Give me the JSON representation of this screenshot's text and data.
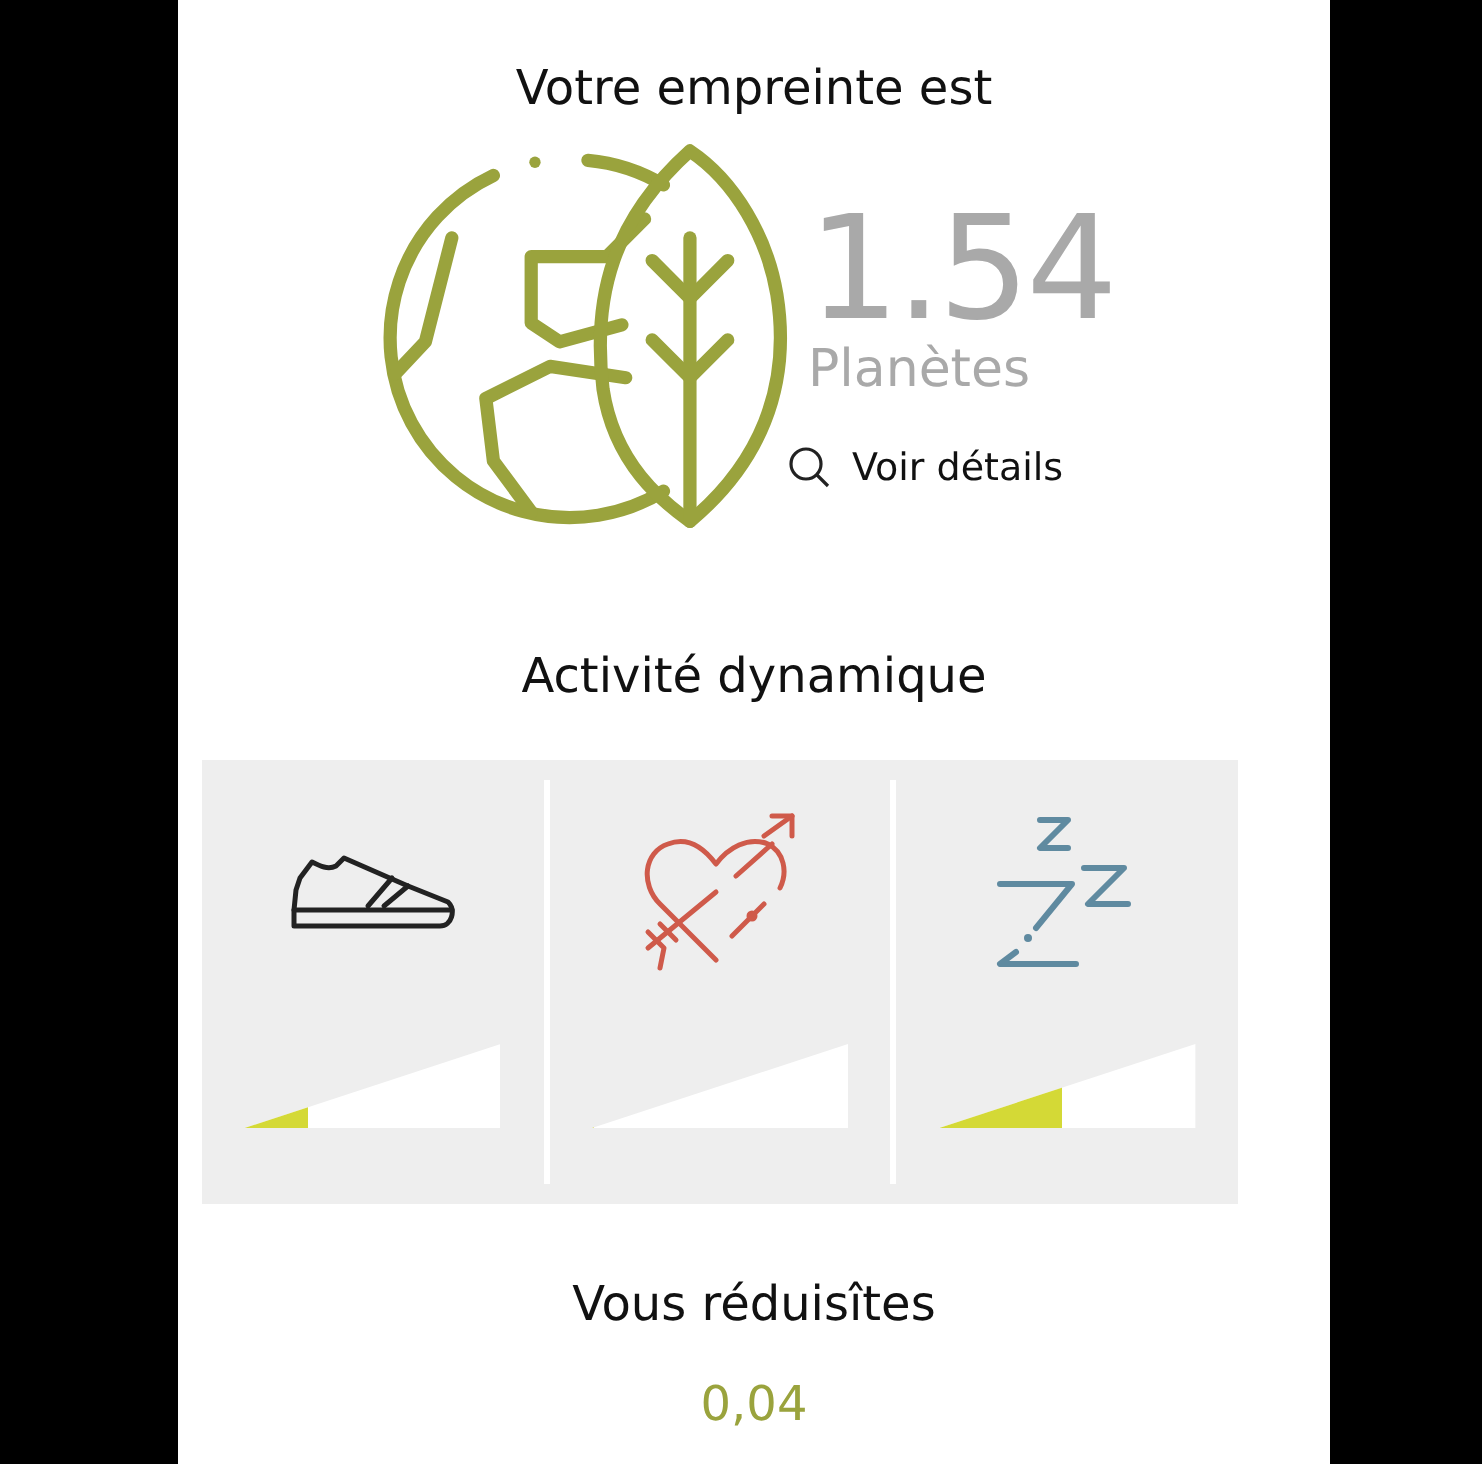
{
  "footprint": {
    "heading": "Votre empreinte est",
    "value": "1.54",
    "unit": "Planètes",
    "details_link": "Voir détails"
  },
  "activity": {
    "heading": "Activité dynamique",
    "items": [
      {
        "kind": "walking",
        "level": 0.25
      },
      {
        "kind": "love",
        "level": 0
      },
      {
        "kind": "sleep",
        "level": 0.48
      }
    ]
  },
  "reduction": {
    "heading": "Vous réduisîtes",
    "value": "0,04"
  }
}
